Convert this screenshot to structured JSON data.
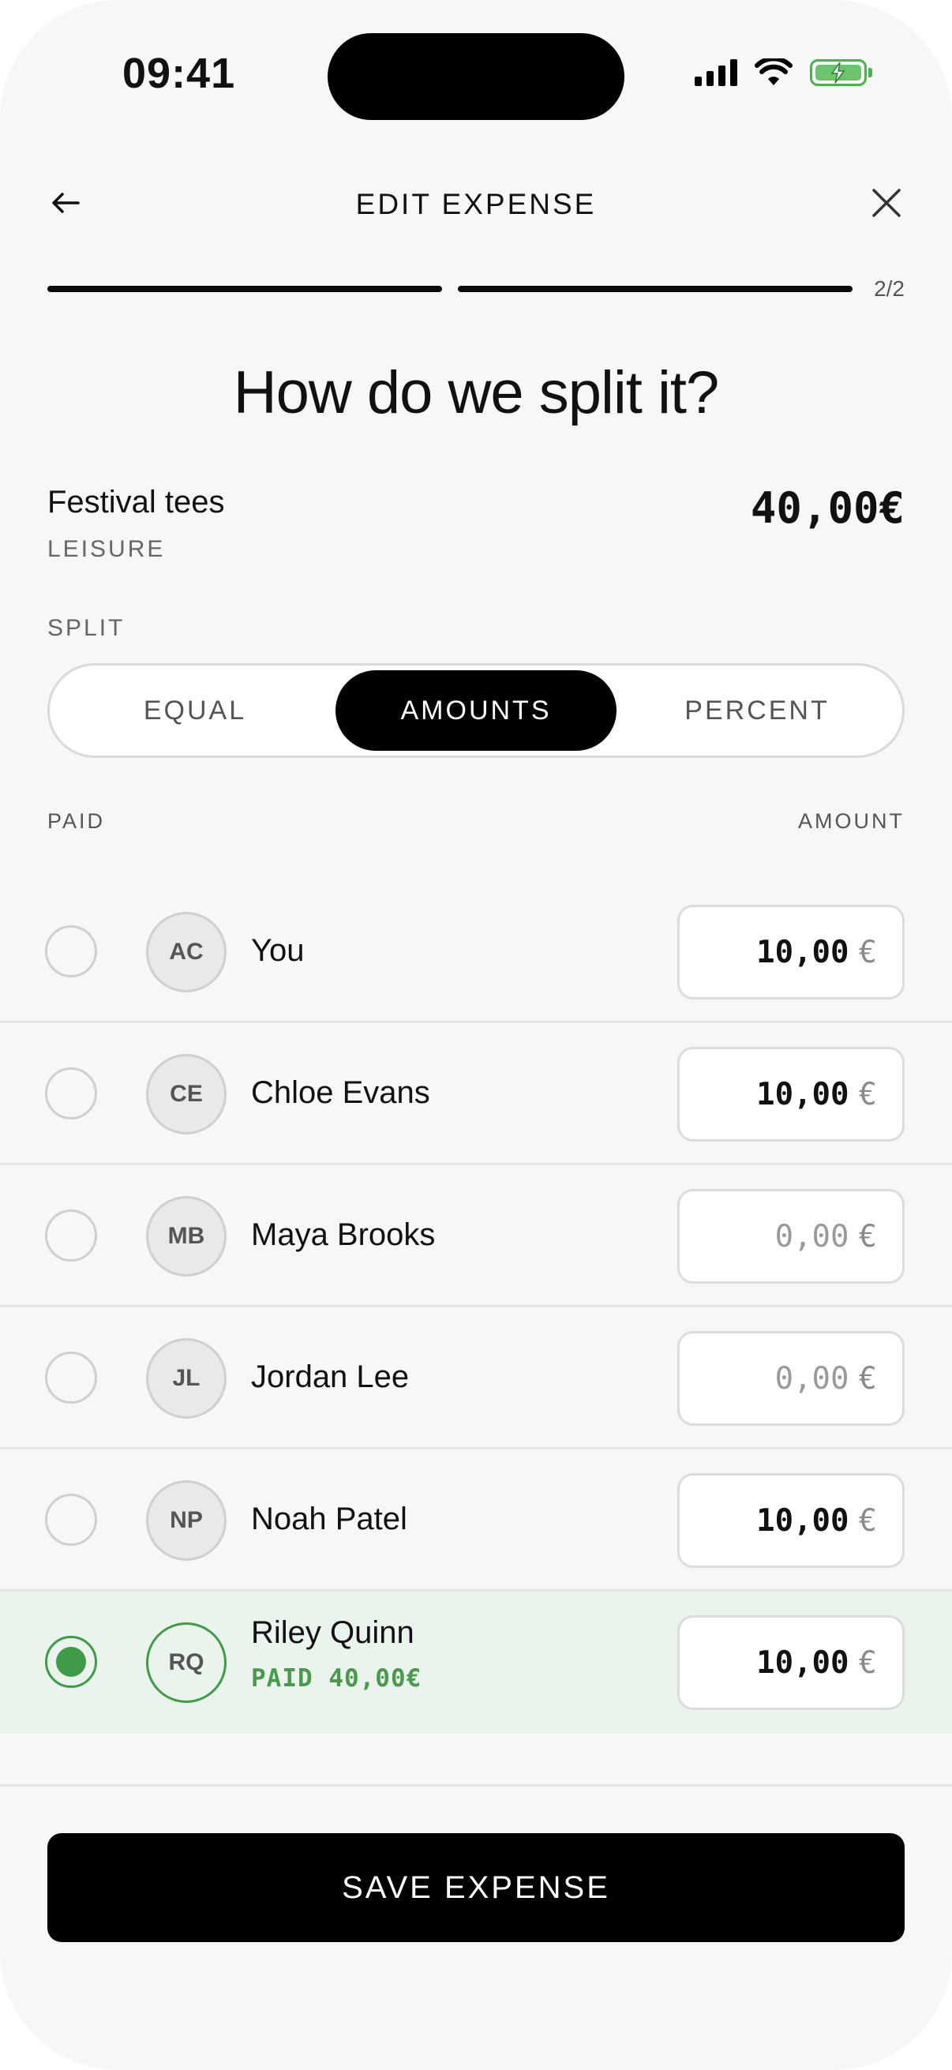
{
  "status_bar": {
    "time": "09:41"
  },
  "header": {
    "title": "EDIT EXPENSE",
    "step": "2/2",
    "progress": {
      "current_step": 2,
      "total_steps": 2
    }
  },
  "heading": "How do we split it?",
  "expense": {
    "name": "Festival tees",
    "category": "LEISURE",
    "amount": "40,00€"
  },
  "split": {
    "label": "SPLIT",
    "options": [
      "EQUAL",
      "AMOUNTS",
      "PERCENT"
    ],
    "selected": "AMOUNTS"
  },
  "columns": {
    "paid": "PAID",
    "amount": "AMOUNT"
  },
  "currency": "€",
  "participants": [
    {
      "initials": "AC",
      "name": "You",
      "amount": "10,00",
      "paid": false
    },
    {
      "initials": "CE",
      "name": "Chloe Evans",
      "amount": "10,00",
      "paid": false
    },
    {
      "initials": "MB",
      "name": "Maya Brooks",
      "amount": "0,00",
      "paid": false
    },
    {
      "initials": "JL",
      "name": "Jordan Lee",
      "amount": "0,00",
      "paid": false
    },
    {
      "initials": "NP",
      "name": "Noah Patel",
      "amount": "10,00",
      "paid": false
    },
    {
      "initials": "RQ",
      "name": "Riley Quinn",
      "amount": "10,00",
      "paid": true,
      "paid_note": "PAID 40,00€"
    }
  ],
  "save_label": "SAVE EXPENSE",
  "colors": {
    "accent_green": "#3f9a4a",
    "selected_row_bg": "#eaf4ec",
    "primary": "#000000"
  }
}
